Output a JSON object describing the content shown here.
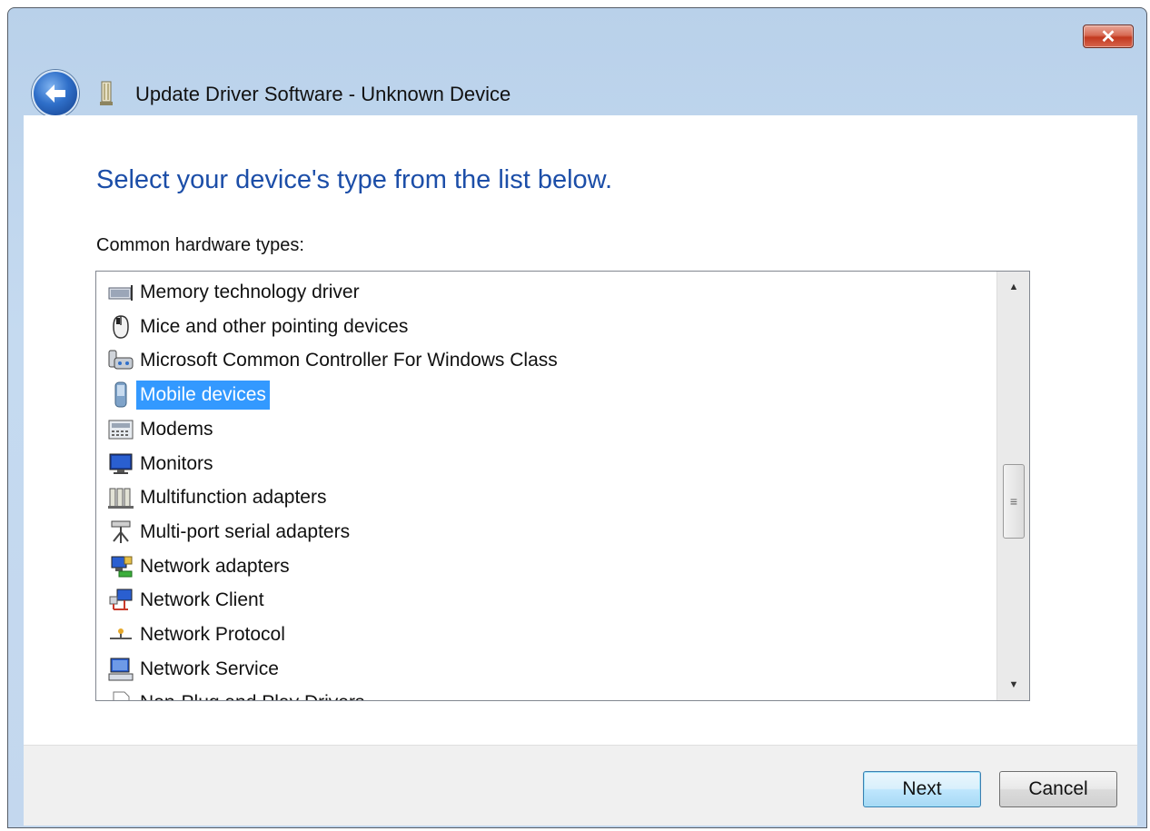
{
  "window": {
    "title": "Update Driver Software - Unknown Device",
    "close_label": "✕",
    "back_icon": "back-arrow-icon"
  },
  "main": {
    "heading": "Select your device's type from the list below.",
    "list_label": "Common hardware types:",
    "items": [
      {
        "label": "Memory technology driver",
        "icon": "memory-card-icon"
      },
      {
        "label": "Mice and other pointing devices",
        "icon": "mouse-icon"
      },
      {
        "label": "Microsoft Common Controller For Windows Class",
        "icon": "game-controller-icon"
      },
      {
        "label": "Mobile devices",
        "icon": "mobile-device-icon",
        "selected": true
      },
      {
        "label": "Modems",
        "icon": "modem-icon"
      },
      {
        "label": "Monitors",
        "icon": "monitor-icon"
      },
      {
        "label": "Multifunction adapters",
        "icon": "multifunction-adapter-icon"
      },
      {
        "label": "Multi-port serial adapters",
        "icon": "serial-adapter-icon"
      },
      {
        "label": "Network adapters",
        "icon": "network-adapter-icon"
      },
      {
        "label": "Network Client",
        "icon": "network-client-icon"
      },
      {
        "label": "Network Protocol",
        "icon": "network-protocol-icon"
      },
      {
        "label": "Network Service",
        "icon": "network-service-icon"
      },
      {
        "label": "Non-Plug and Play Drivers",
        "icon": "document-icon"
      }
    ],
    "scroll_up": "▲",
    "scroll_down": "▼",
    "scroll_grip": "≡"
  },
  "footer": {
    "next_label": "Next",
    "cancel_label": "Cancel"
  },
  "colors": {
    "heading": "#1c4ea8",
    "selection": "#3399ff",
    "frame": "#c3d7ee"
  }
}
